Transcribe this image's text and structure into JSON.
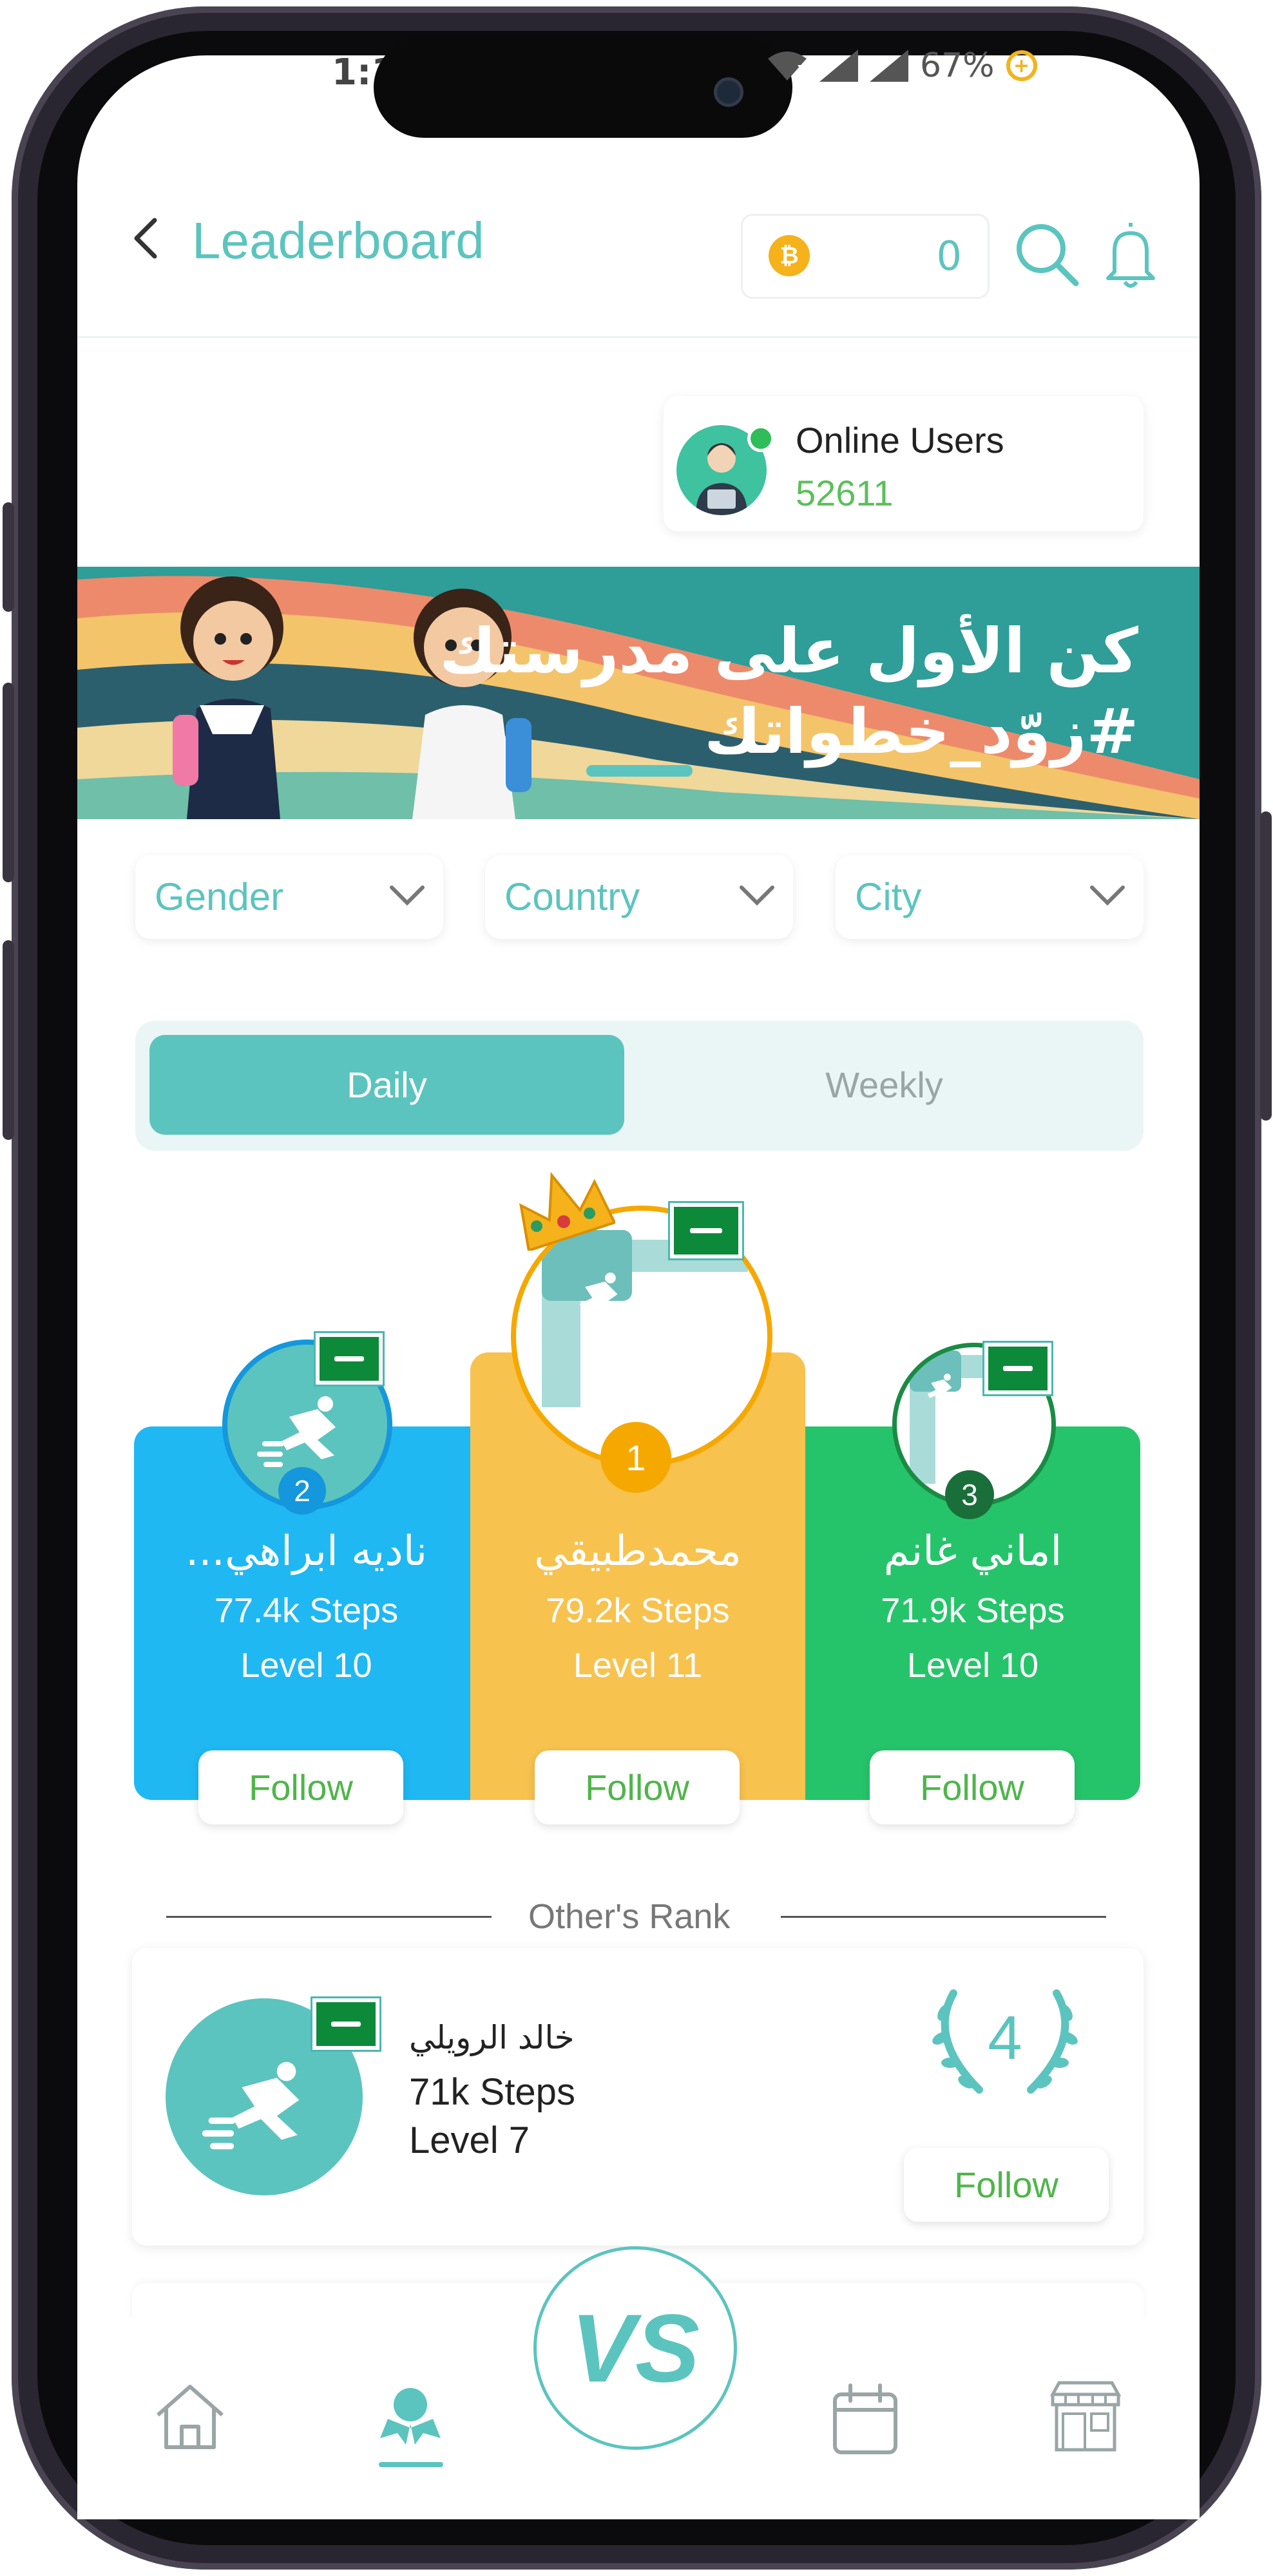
{
  "status_bar": {
    "time": "1:1",
    "battery": "67%"
  },
  "header": {
    "title": "Leaderboard",
    "coins": "0"
  },
  "online_users": {
    "label": "Online Users",
    "count": "52611"
  },
  "banner": {
    "line1": "كن الأول على مدرستك",
    "line2": "#زوّد_خطواتك"
  },
  "filters": [
    {
      "label": "Gender"
    },
    {
      "label": "Country"
    },
    {
      "label": "City"
    }
  ],
  "tabs": {
    "daily": "Daily",
    "weekly": "Weekly",
    "selected": "Daily"
  },
  "podium": {
    "first": {
      "rank": "1",
      "name": "محمدطبيقي",
      "steps": "79.2k Steps",
      "level": "Level 11",
      "follow": "Follow"
    },
    "second": {
      "rank": "2",
      "name": "ناديه ابراهي...",
      "steps": "77.4k Steps",
      "level": "Level 10",
      "follow": "Follow"
    },
    "third": {
      "rank": "3",
      "name": "اماني  غانم",
      "steps": "71.9k Steps",
      "level": "Level 10",
      "follow": "Follow"
    }
  },
  "others": {
    "heading": "Other's Rank",
    "items": [
      {
        "rank": "4",
        "name": "خالد الرويلي",
        "steps": "71k Steps",
        "level": "Level 7",
        "follow": "Follow"
      }
    ]
  },
  "bottom_nav": {
    "items": [
      "home-icon",
      "leaderboard-icon",
      "vs-icon",
      "calendar-icon",
      "store-icon"
    ],
    "active": "leaderboard-icon",
    "vs_label": "VS"
  },
  "colors": {
    "accent": "#5cc4bf",
    "first": "#f8c24f",
    "second": "#1fb8f3",
    "third": "#26c46a",
    "follow_text": "#4fb54a"
  }
}
